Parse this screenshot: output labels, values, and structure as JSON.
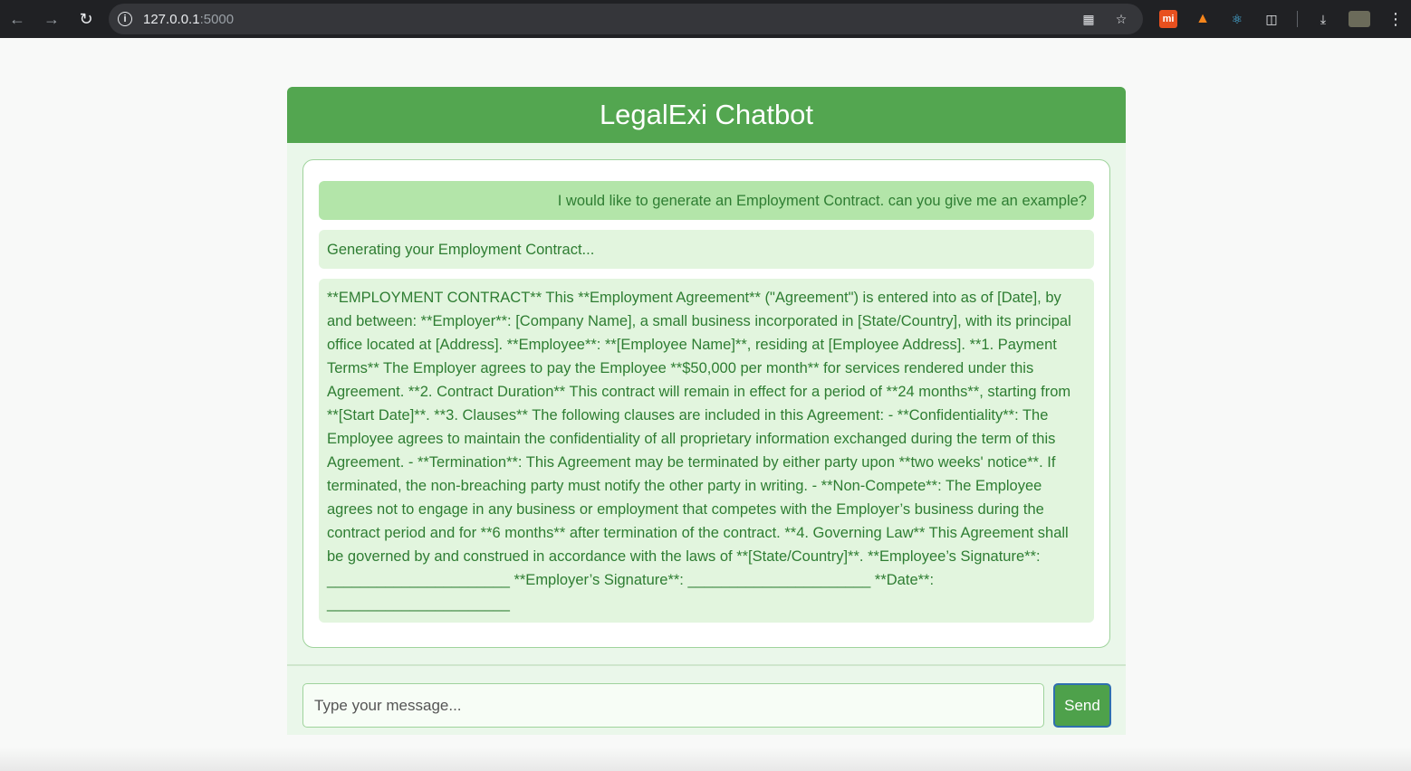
{
  "browser": {
    "url_host": "127.0.0.1",
    "url_port": ":5000"
  },
  "app": {
    "title": "LegalExi Chatbot"
  },
  "messages": [
    {
      "role": "user",
      "text": "I would like to generate an Employment Contract. can you give me an example?"
    },
    {
      "role": "bot",
      "text": "Generating your Employment Contract..."
    },
    {
      "role": "bot",
      "text": "**EMPLOYMENT CONTRACT** This **Employment Agreement** (\"Agreement\") is entered into as of [Date], by and between: **Employer**: [Company Name], a small business incorporated in [State/Country], with its principal office located at [Address]. **Employee**: **[Employee Name]**, residing at [Employee Address]. **1. Payment Terms** The Employer agrees to pay the Employee **$50,000 per month** for services rendered under this Agreement. **2. Contract Duration** This contract will remain in effect for a period of **24 months**, starting from **[Start Date]**. **3. Clauses** The following clauses are included in this Agreement: - **Confidentiality**: The Employee agrees to maintain the confidentiality of all proprietary information exchanged during the term of this Agreement. - **Termination**: This Agreement may be terminated by either party upon **two weeks' notice**. If terminated, the non-breaching party must notify the other party in writing. - **Non-Compete**: The Employee agrees not to engage in any business or employment that competes with the Employer’s business during the contract period and for **6 months** after termination of the contract. **4. Governing Law** This Agreement shall be governed by and construed in accordance with the laws of **[State/Country]**. **Employee’s Signature**: ______________________ **Employer’s Signature**: ______________________ **Date**: ______________________"
    }
  ],
  "input": {
    "placeholder": "Type your message...",
    "value": ""
  },
  "send_label": "Send",
  "colors": {
    "header": "#53a650",
    "user_bubble": "#b3e5a9",
    "bot_bubble": "#e2f5de",
    "text": "#2e7d32",
    "send_border": "#2f6fb0"
  }
}
